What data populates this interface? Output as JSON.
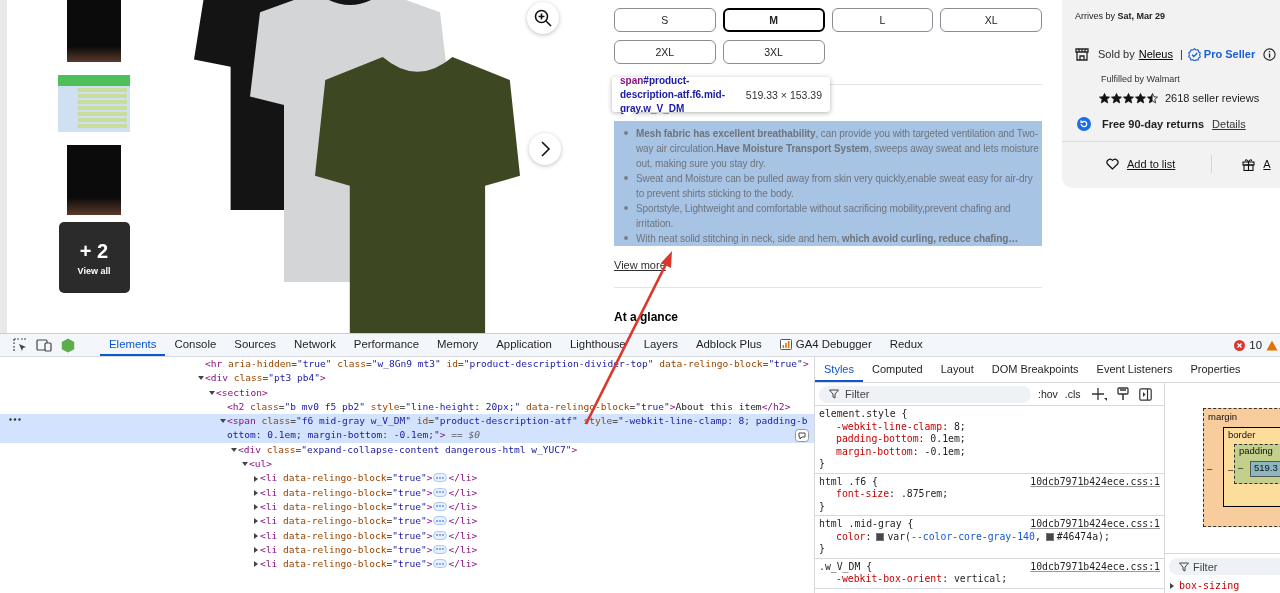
{
  "gallery": {
    "thumbnails": [
      {
        "kind": "photo"
      },
      {
        "kind": "size-chart"
      },
      {
        "kind": "photo"
      },
      {
        "kind": "more",
        "count": "+ 2",
        "label": "View all"
      }
    ]
  },
  "sizes": [
    {
      "label": "S",
      "selected": false
    },
    {
      "label": "M",
      "selected": true
    },
    {
      "label": "L",
      "selected": false
    },
    {
      "label": "XL",
      "selected": false
    },
    {
      "label": "2XL",
      "selected": false
    },
    {
      "label": "3XL",
      "selected": false
    }
  ],
  "inspect_tooltip": {
    "tag": "span",
    "selector": "#product-description-atf.f6.mid-gray.w_V_DM",
    "dimensions": "519.33 × 153.39"
  },
  "description": {
    "highlighted": true,
    "bullets": [
      "**Mesh fabric has excellent breathability**, can provide you with targeted ventilation and Two-way air circulation.**Have Moisture Transport System**, sweeps away sweat and lets moisture out, making sure you stay dry.",
      "Sweat and Moisture can be pulled away from skin very quickly,enable sweat easy for air-dry to prevent shirts sticking to the body.",
      "Sportstyle, Lightweight and comfortable without sacrificing mobility,prevent chafing and irritation.",
      "With neat solid stitching in neck, side and hem, **which avoid curling, reduce chafing…**"
    ]
  },
  "view_more": "View more",
  "at_a_glance": "At a glance",
  "seller_card": {
    "arrives": "Arrives by **Sat, Mar 29**",
    "sold_by": "Sold by",
    "seller": "Neleus",
    "separator": "|",
    "badge": "Pro Seller",
    "fulfilled": "Fulfilled by Walmart",
    "stars": 4.5,
    "reviews": "2618 seller reviews",
    "returns": "Free 90-day returns",
    "returns_link": "Details",
    "actions": [
      {
        "kind": "list",
        "label": "Add to list"
      },
      {
        "kind": "gift",
        "label": "A"
      }
    ]
  },
  "devtools": {
    "tabs": [
      {
        "label": "Elements",
        "selected": true
      },
      {
        "label": "Console",
        "selected": false
      },
      {
        "label": "Sources",
        "selected": false
      },
      {
        "label": "Network",
        "selected": false
      },
      {
        "label": "Performance",
        "selected": false
      },
      {
        "label": "Memory",
        "selected": false
      },
      {
        "label": "Application",
        "selected": false
      },
      {
        "label": "Lighthouse",
        "selected": false
      },
      {
        "label": "Layers",
        "selected": false
      },
      {
        "label": "Adblock Plus",
        "selected": false
      },
      {
        "label": "GA4 Debugger",
        "selected": false
      },
      {
        "label": "Redux",
        "selected": false
      }
    ],
    "error_count": "10",
    "dom_tree": [
      {
        "kind": "leaf",
        "text": "<hr aria-hidden=\"true\" class=\"w_8Gn9 mt3\" id=\"product-description-divider-top\" data-relingo-block=\"true\">",
        "selected": false
      },
      {
        "kind": "parent",
        "expanded": true,
        "text": "<div class=\"pt3 pb4\">",
        "selected": false,
        "children": [
          {
            "kind": "parent",
            "expanded": true,
            "text": "<section>",
            "selected": false,
            "children": [
              {
                "kind": "leaf",
                "text": "<h2 class=\"b mv0 f5 pb2\" style=\"line-height: 20px;\" data-relingo-block=\"true\">About this item</h2>",
                "selected": false
              },
              {
                "kind": "parent",
                "expanded": true,
                "text": "<span class=\"f6 mid-gray w_V_DM\" id=\"product-description-atf\" style=\"-webkit-line-clamp: 8; padding-bottom: 0.1em; margin-bottom: -0.1em;\">",
                "suffix": " == $0",
                "selected": true,
                "children": [
                  {
                    "kind": "parent",
                    "expanded": true,
                    "text": "<div class=\"expand-collapse-content dangerous-html w_YUC7\">",
                    "selected": false,
                    "children": [
                      {
                        "kind": "parent",
                        "expanded": true,
                        "text": "<ul>",
                        "selected": false,
                        "children": [
                          {
                            "kind": "parent",
                            "expanded": false,
                            "text": "<li data-relingo-block=\"true\">",
                            "close": "</li>",
                            "selected": false
                          },
                          {
                            "kind": "parent",
                            "expanded": false,
                            "text": "<li data-relingo-block=\"true\">",
                            "close": "</li>",
                            "selected": false
                          },
                          {
                            "kind": "parent",
                            "expanded": false,
                            "text": "<li data-relingo-block=\"true\">",
                            "close": "</li>",
                            "selected": false
                          },
                          {
                            "kind": "parent",
                            "expanded": false,
                            "text": "<li data-relingo-block=\"true\">",
                            "close": "</li>",
                            "selected": false
                          },
                          {
                            "kind": "parent",
                            "expanded": false,
                            "text": "<li data-relingo-block=\"true\">",
                            "close": "</li>",
                            "selected": false
                          },
                          {
                            "kind": "parent",
                            "expanded": false,
                            "text": "<li data-relingo-block=\"true\">",
                            "close": "</li>",
                            "selected": false
                          },
                          {
                            "kind": "parent",
                            "expanded": false,
                            "text": "<li data-relingo-block=\"true\">",
                            "close": "</li>",
                            "selected": false
                          }
                        ]
                      }
                    ]
                  }
                ]
              }
            ]
          }
        ]
      }
    ],
    "styles_tabs": [
      {
        "label": "Styles",
        "selected": true
      },
      {
        "label": "Computed",
        "selected": false
      },
      {
        "label": "Layout",
        "selected": false
      },
      {
        "label": "DOM Breakpoints",
        "selected": false
      },
      {
        "label": "Event Listeners",
        "selected": false
      },
      {
        "label": "Properties",
        "selected": false
      }
    ],
    "filter_placeholder": "Filter",
    "hov": ":hov",
    "cls": ".cls",
    "rules": [
      {
        "selector": "element.style {",
        "props": [
          {
            "name": "-webkit-line-clamp",
            "parts": [
              {
                "kind": "text",
                "text": ": 8;"
              }
            ]
          },
          {
            "name": "padding-bottom",
            "parts": [
              {
                "kind": "text",
                "text": ": 0.1em;"
              }
            ]
          },
          {
            "name": "margin-bottom",
            "parts": [
              {
                "kind": "text",
                "text": ": -0.1em;"
              }
            ]
          }
        ],
        "close": "}"
      },
      {
        "selector": "html .f6 {",
        "source": "10dcb7971b424ece.css:1",
        "props": [
          {
            "name": "font-size",
            "parts": [
              {
                "kind": "text",
                "text": ": .875rem;"
              }
            ]
          }
        ],
        "close": "}"
      },
      {
        "selector": "html .mid-gray {",
        "source": "10dcb7971b424ece.css:1",
        "props": [
          {
            "name": "color",
            "parts": [
              {
                "kind": "text",
                "text": ":"
              },
              {
                "kind": "swatch",
                "color": "#46474a"
              },
              {
                "kind": "text",
                "text": "var("
              },
              {
                "kind": "var",
                "text": "--color-core-gray-140"
              },
              {
                "kind": "text",
                "text": ","
              },
              {
                "kind": "swatch",
                "color": "#46474a"
              },
              {
                "kind": "text",
                "text": "#46474a);"
              }
            ]
          }
        ],
        "close": "}"
      },
      {
        "selector": ".w_V_DM {",
        "source": "10dcb7971b424ece.css:1",
        "props": [
          {
            "name": "-webkit-box-orient",
            "parts": [
              {
                "kind": "text",
                "text": ": vertical;"
              }
            ]
          }
        ]
      }
    ],
    "box_model": {
      "margin": "margin",
      "border": "border",
      "padding": "padding",
      "content": "519.3",
      "dash": "–"
    },
    "computed": {
      "filter_placeholder": "Filter",
      "properties": [
        {
          "name": "box-sizing",
          "expanded": false
        }
      ]
    }
  }
}
